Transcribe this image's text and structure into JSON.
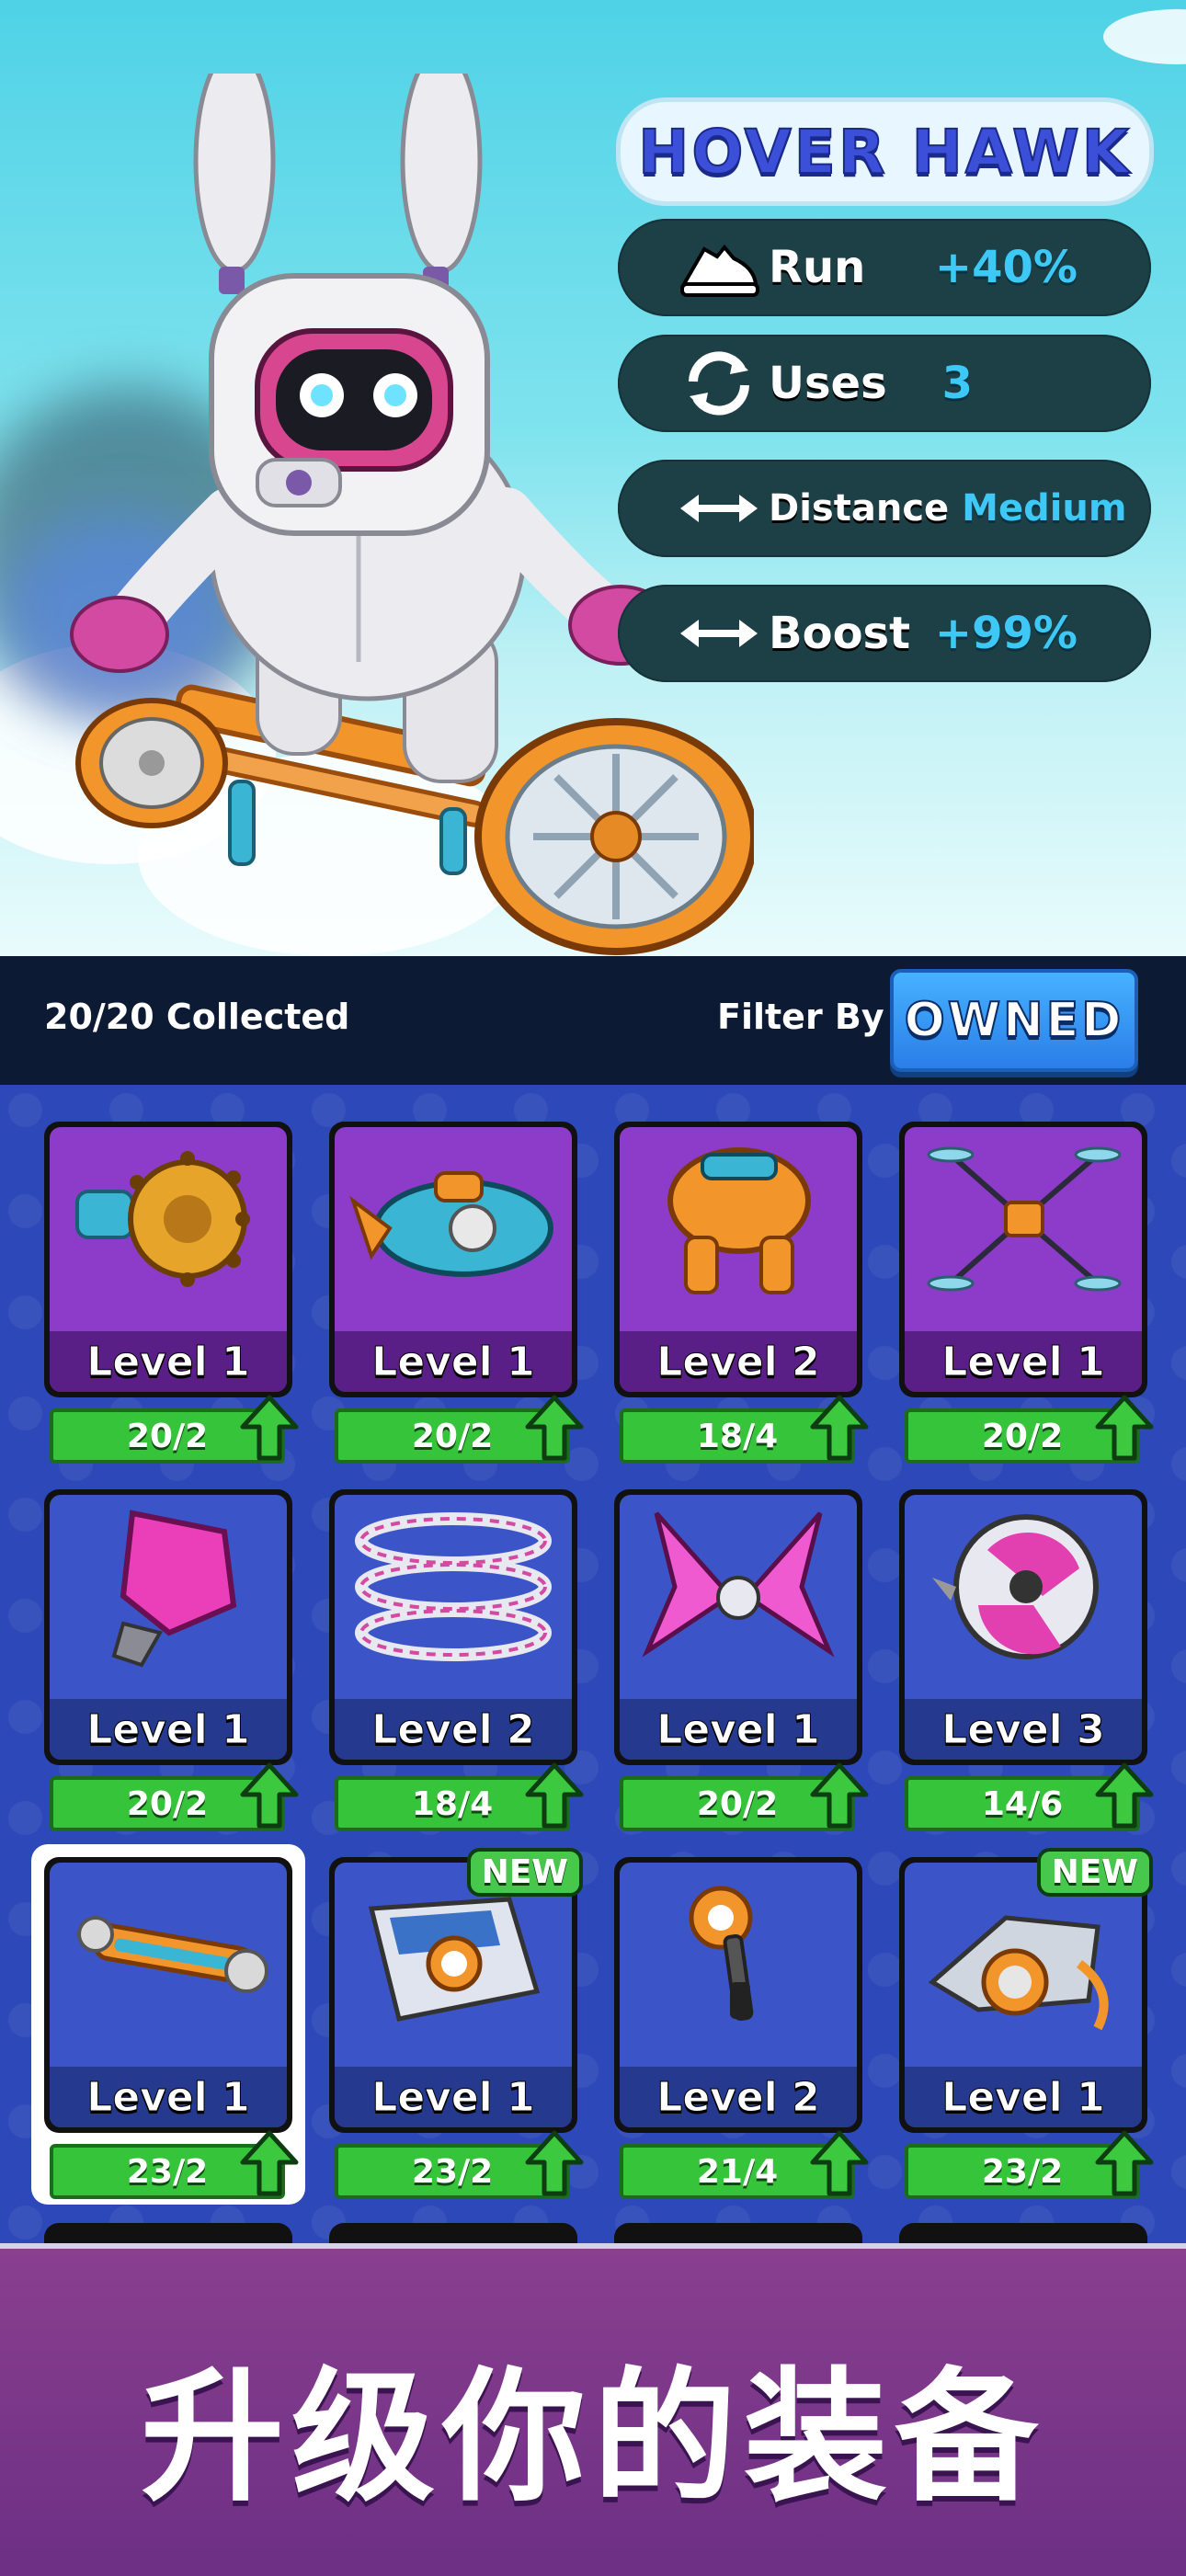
{
  "hero": {
    "title": "HOVER HAWK",
    "stats": [
      {
        "label": "Run",
        "value": "+40%",
        "icon": "shoe-icon"
      },
      {
        "label": "Uses",
        "value": "3",
        "icon": "refresh-icon"
      },
      {
        "label": "Distance",
        "value": "Medium",
        "icon": "double-arrow-icon"
      },
      {
        "label": "Boost",
        "value": "+99%",
        "icon": "double-arrow-icon"
      }
    ]
  },
  "header": {
    "collected": "20/20 Collected",
    "filter_label": "Filter By :",
    "filter_value": "OWNED"
  },
  "items": [
    {
      "level": "Level 1",
      "progress": "20/2",
      "theme": "purple",
      "art": "spiked-drum"
    },
    {
      "level": "Level 1",
      "progress": "20/2",
      "theme": "purple",
      "art": "blue-rocket"
    },
    {
      "level": "Level 2",
      "progress": "18/4",
      "theme": "purple",
      "art": "orange-mech"
    },
    {
      "level": "Level 1",
      "progress": "20/2",
      "theme": "purple",
      "art": "drone"
    },
    {
      "level": "Level 1",
      "progress": "20/2",
      "theme": "blue",
      "art": "pink-crystal"
    },
    {
      "level": "Level 2",
      "progress": "18/4",
      "theme": "blue",
      "art": "spring"
    },
    {
      "level": "Level 1",
      "progress": "20/2",
      "theme": "blue",
      "art": "pink-wings"
    },
    {
      "level": "Level 3",
      "progress": "14/6",
      "theme": "blue",
      "art": "pink-orb"
    },
    {
      "level": "Level 1",
      "progress": "23/2",
      "theme": "blue",
      "art": "hover-board",
      "selected": true
    },
    {
      "level": "Level 1",
      "progress": "23/2",
      "theme": "blue",
      "art": "jet-pack",
      "badge": "NEW"
    },
    {
      "level": "Level 2",
      "progress": "21/4",
      "theme": "blue",
      "art": "blaster"
    },
    {
      "level": "Level 1",
      "progress": "23/2",
      "theme": "blue",
      "art": "turbine",
      "badge": "NEW"
    }
  ],
  "banner": {
    "text": "升级你的装备"
  },
  "colors": {
    "accent_blue": "#3dc8f5",
    "purple_card": "#8d3cc9",
    "blue_card": "#3b55c9",
    "progress_green": "#35c43a",
    "banner_purple": "#7a3789"
  }
}
